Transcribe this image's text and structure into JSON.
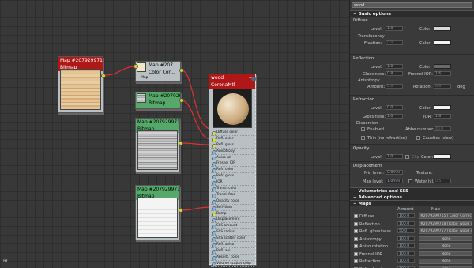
{
  "canvas": {
    "nodes": [
      {
        "title": "Map #2079299715 (wood_diff.jpg)",
        "subtitle": "Bitmap"
      },
      {
        "title": "Map #207...",
        "subtitle": "Color Cor...",
        "output": "Map"
      },
      {
        "title": "Map #207029...",
        "subtitle": "Bitmap"
      },
      {
        "title": "Map #2079299717",
        "subtitle": "Bitmap"
      },
      {
        "title": "Map #2079299716",
        "subtitle": "Bitmap"
      }
    ],
    "material": {
      "title": "wood",
      "subtitle": "CoronaMtl",
      "sockets": [
        "Diffuse color",
        "Refl. color",
        "Refl. gloss",
        "Anisotropy",
        "Aniso rot",
        "Fresnel IOR",
        "Refr. color",
        "Refr. gloss",
        "IOR",
        "Transl. color",
        "Transl. frac",
        "Opacity color",
        "Self-illum",
        "Bump",
        "Displacement",
        "SSS amount",
        "SSS radius",
        "SSS scatter color",
        "Refl. aniso",
        "Refl. ani",
        "Absorb. color",
        "Volume scatter color",
        "mr Connection"
      ]
    }
  },
  "panel": {
    "search": "wood",
    "basic_options": "Basic options",
    "diffuse": {
      "label": "Diffuse",
      "level_label": "Level:",
      "level": "1.0",
      "color_label": "Color:",
      "color": "#d8d8d8",
      "translucency_label": "Translucency",
      "fraction_label": "Fraction:",
      "fraction": "0.0",
      "t_color_label": "Color:",
      "t_color": "#f2f2f2"
    },
    "reflection": {
      "label": "Reflection",
      "level_label": "Level:",
      "level": "1.0",
      "color_label": "Color:",
      "color": "#6a6a6a",
      "gloss_label": "Glossiness:",
      "gloss": "0.8",
      "fresnel_label": "Fresnel IOR:",
      "fresnel": "1.6",
      "aniso_label": "Anisotropy",
      "amount_label": "Amount:",
      "amount": "0.0",
      "rotation_label": "Rotation:",
      "rotation": "0.0",
      "deg": "deg"
    },
    "refraction": {
      "label": "Refraction",
      "level_label": "Level:",
      "level": "0.0",
      "color_label": "Color:",
      "color": "#f2f2f2",
      "gloss_label": "Glossiness:",
      "gloss": "1.0",
      "ior_label": "IOR:",
      "ior": "1.6",
      "dispersion_label": "Dispersion",
      "enabled_label": "Enabled",
      "abbe_label": "Abbe number:",
      "abbe": "40.0",
      "thin_label": "Thin (no refraction)",
      "caustics_label": "Caustics (slow)"
    },
    "opacity": {
      "label": "Opacity",
      "level_label": "Level:",
      "level": "1.0",
      "clip_label": "Clip",
      "color_label": "Color:",
      "color": "#f2f2f2"
    },
    "displacement": {
      "label": "Displacement",
      "min_label": "Min level:",
      "min": "0.0mm",
      "texture_label": "Texture:",
      "max_label": "Max level:",
      "max": "1.0mm",
      "water_label": "Water lvl.:",
      "water": "0.5"
    },
    "volumetrics": "Volumetrics and SSS",
    "advanced": "Advanced options",
    "maps_title": "Maps",
    "maps_head": {
      "amount": "Amount",
      "map": "Map"
    },
    "maps": [
      {
        "name": "Diffuse",
        "amount": "100.0",
        "map": "#2079299715 ( Color Correctio"
      },
      {
        "name": "Reflection",
        "amount": "100.0",
        "map": "#2079299718 (Isabo_wood_refl"
      },
      {
        "name": "Refl. glossiness",
        "amount": "50.0",
        "map": "#2079299717 (Isabo_wood_refl"
      },
      {
        "name": "Anisotropy",
        "amount": "100.0",
        "map": "None"
      },
      {
        "name": "Aniso rotation",
        "amount": "100.0",
        "map": "None"
      },
      {
        "name": "Fresnel IOR",
        "amount": "100.0",
        "map": "None"
      },
      {
        "name": "Refraction",
        "amount": "100.0",
        "map": "None"
      },
      {
        "name": "Refr. glossiness",
        "amount": "100.0",
        "map": "None"
      }
    ]
  }
}
